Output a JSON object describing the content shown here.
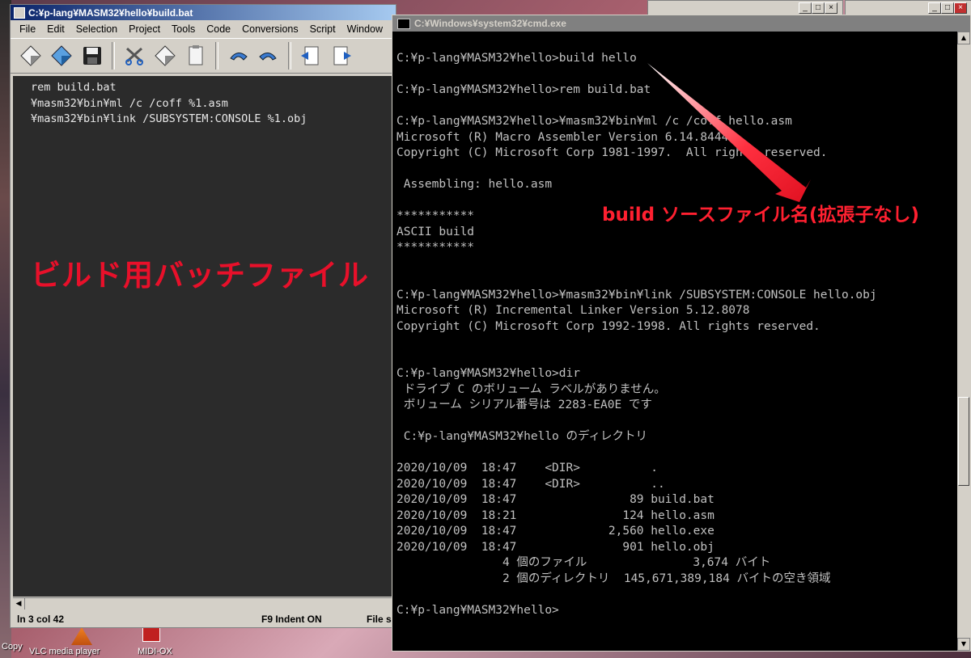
{
  "editor": {
    "title": "C:¥p-lang¥MASM32¥hello¥build.bat",
    "menu": [
      "File",
      "Edit",
      "Selection",
      "Project",
      "Tools",
      "Code",
      "Conversions",
      "Script",
      "Window"
    ],
    "toolbar_icons": [
      "new-file-icon",
      "open-file-icon",
      "save-icon",
      "cut-icon",
      "copy-icon",
      "paste-icon",
      "undo-icon",
      "redo-icon",
      "import-icon",
      "export-icon"
    ],
    "lines": [
      "rem build.bat",
      "¥masm32¥bin¥ml /c /coff %1.asm",
      "¥masm32¥bin¥link /SUBSYSTEM:CONSOLE %1.obj"
    ],
    "status": {
      "position": "ln 3 col 42",
      "indent": "F9 Indent ON",
      "file": "File s"
    }
  },
  "annotations": {
    "left": "ビルド用バッチファイル",
    "right": "build ソースファイル名(拡張子なし)",
    "color": "#e8102a"
  },
  "cmd": {
    "title": "C:¥Windows¥system32¥cmd.exe",
    "lines": [
      "C:¥p-lang¥MASM32¥hello>build hello",
      "",
      "C:¥p-lang¥MASM32¥hello>rem build.bat",
      "",
      "C:¥p-lang¥MASM32¥hello>¥masm32¥bin¥ml /c /coff hello.asm",
      "Microsoft (R) Macro Assembler Version 6.14.8444",
      "Copyright (C) Microsoft Corp 1981-1997.  All rights reserved.",
      "",
      " Assembling: hello.asm",
      "",
      "***********",
      "ASCII build",
      "***********",
      "",
      "",
      "C:¥p-lang¥MASM32¥hello>¥masm32¥bin¥link /SUBSYSTEM:CONSOLE hello.obj",
      "Microsoft (R) Incremental Linker Version 5.12.8078",
      "Copyright (C) Microsoft Corp 1992-1998. All rights reserved.",
      "",
      "",
      "C:¥p-lang¥MASM32¥hello>dir",
      " ドライブ C のボリューム ラベルがありません。",
      " ボリューム シリアル番号は 2283-EA0E です",
      "",
      " C:¥p-lang¥MASM32¥hello のディレクトリ",
      "",
      "2020/10/09  18:47    <DIR>          .",
      "2020/10/09  18:47    <DIR>          ..",
      "2020/10/09  18:47                89 build.bat",
      "2020/10/09  18:21               124 hello.asm",
      "2020/10/09  18:47             2,560 hello.exe",
      "2020/10/09  18:47               901 hello.obj",
      "               4 個のファイル               3,674 バイト",
      "               2 個のディレクトリ  145,671,389,184 バイトの空き領域",
      "",
      "C:¥p-lang¥MASM32¥hello>"
    ]
  },
  "desktop": {
    "icons": [
      {
        "label": "VLC media player",
        "icon": "vlc-icon"
      },
      {
        "label": "MIDI-OX",
        "icon": "midi-ox-icon"
      },
      {
        "label": "Copy",
        "icon": "shortcut-icon"
      }
    ]
  }
}
